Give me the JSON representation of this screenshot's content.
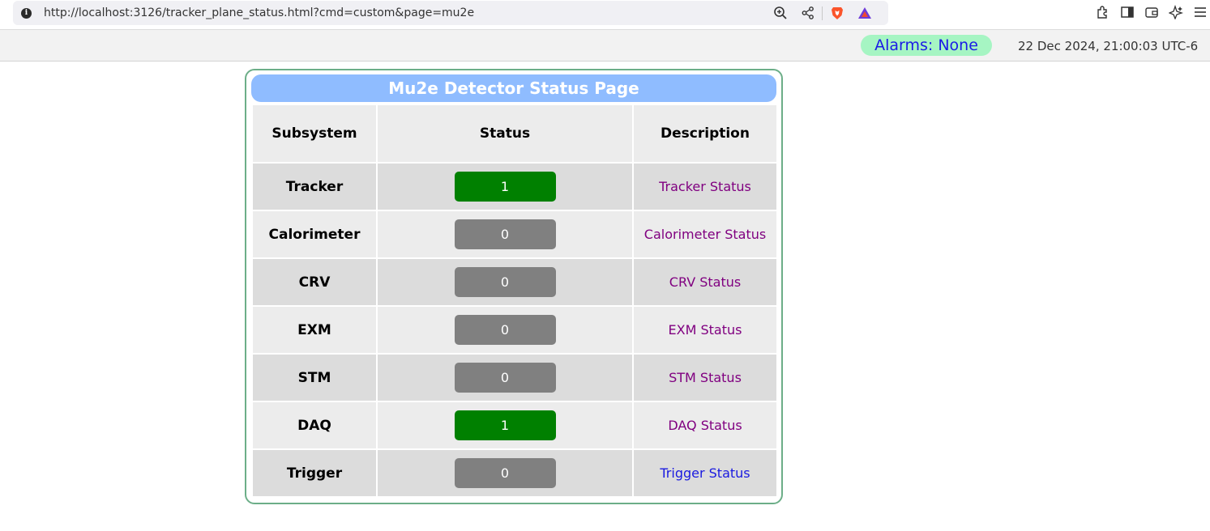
{
  "browser": {
    "url": "http://localhost:3126/tracker_plane_status.html?cmd=custom&page=mu2e",
    "icons": [
      "info-icon",
      "zoom-icon",
      "share-icon",
      "brave-shields-icon",
      "brave-rewards-icon",
      "extensions-icon",
      "sidebar-icon",
      "wallet-icon",
      "leo-ai-icon",
      "menu-icon"
    ]
  },
  "header": {
    "alarms": "Alarms: None",
    "datetime": "22 Dec 2024, 21:00:03 UTC-6"
  },
  "panel": {
    "title": "Mu2e Detector Status Page",
    "columns": [
      "Subsystem",
      "Status",
      "Description"
    ],
    "rows": [
      {
        "subsystem": "Tracker",
        "status": "1",
        "description": "Tracker Status"
      },
      {
        "subsystem": "Calorimeter",
        "status": "0",
        "description": "Calorimeter Status"
      },
      {
        "subsystem": "CRV",
        "status": "0",
        "description": "CRV Status"
      },
      {
        "subsystem": "EXM",
        "status": "0",
        "description": "EXM Status"
      },
      {
        "subsystem": "STM",
        "status": "0",
        "description": "STM Status"
      },
      {
        "subsystem": "DAQ",
        "status": "1",
        "description": "DAQ Status"
      },
      {
        "subsystem": "Trigger",
        "status": "0",
        "description": "Trigger Status"
      }
    ]
  },
  "colors": {
    "status_on": "#008000",
    "status_off": "#808080",
    "title_bar": "#8fbcff",
    "alarm_badge": "#a6f5c3",
    "visited_link": "#800080",
    "unvisited_link": "#1a1ae0"
  }
}
